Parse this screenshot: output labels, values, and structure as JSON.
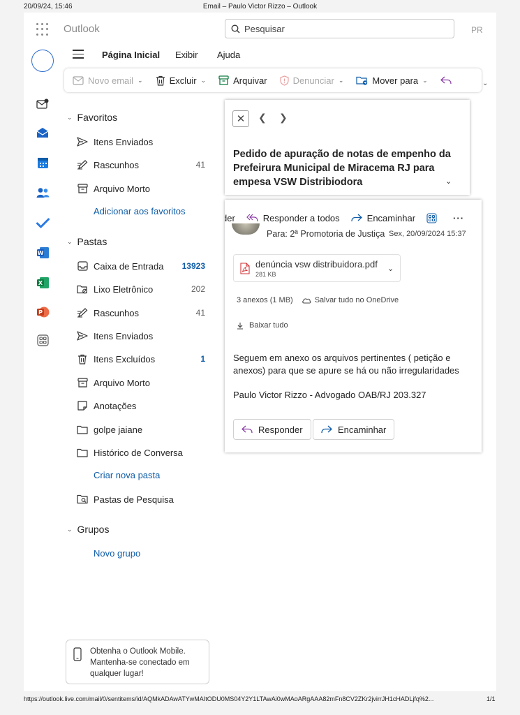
{
  "print": {
    "datetime": "20/09/24, 15:46",
    "doc_title": "Email – Paulo Victor Rizzo – Outlook",
    "url": "https://outlook.live.com/mail/0/sentitems/id/AQMkADAwATYwMAItODU0MS04Y2Y1LTAwAi0wMAoARgAAA82mFn8CV2ZKr2jvirrJH1cHADLjfq%2...",
    "page_num": "1/1"
  },
  "topbar": {
    "app_name": "Outlook",
    "search_placeholder": "Pesquisar",
    "user_initials": "PR"
  },
  "ribbon": {
    "tabs": [
      "Página Inicial",
      "Exibir",
      "Ajuda"
    ],
    "new_email": "Novo email",
    "delete": "Excluir",
    "archive": "Arquivar",
    "report": "Denunciar",
    "move_to": "Mover para"
  },
  "favorites": {
    "title": "Favoritos",
    "items": [
      {
        "label": "Itens Enviados",
        "count": ""
      },
      {
        "label": "Rascunhos",
        "count": "41"
      },
      {
        "label": "Arquivo Morto",
        "count": ""
      }
    ],
    "add_link": "Adicionar aos favoritos"
  },
  "folders": {
    "title": "Pastas",
    "items": [
      {
        "label": "Caixa de Entrada",
        "count": "13923"
      },
      {
        "label": "Lixo Eletrônico",
        "count": "202"
      },
      {
        "label": "Rascunhos",
        "count": "41"
      },
      {
        "label": "Itens Enviados",
        "count": ""
      },
      {
        "label": "Itens Excluídos",
        "count": "1"
      },
      {
        "label": "Arquivo Morto",
        "count": ""
      },
      {
        "label": "Anotações",
        "count": ""
      },
      {
        "label": "golpe jaiane",
        "count": ""
      },
      {
        "label": "Histórico de Conversa",
        "count": ""
      }
    ],
    "create_link": "Criar nova pasta",
    "search_folders": "Pastas de Pesquisa"
  },
  "groups": {
    "title": "Grupos",
    "new_link": "Novo grupo"
  },
  "mobile_promo": {
    "line1": "Obtenha o Outlook Mobile.",
    "line2": "Mantenha-se conectado em",
    "line3": "qualquer lugar!"
  },
  "message": {
    "subject": "Pedido de apuração de notas de empenho da Prefeirura Municipal de Miracema RJ para empesa VSW Distribiodora",
    "action_partial": "der",
    "reply_all": "Responder a todos",
    "forward": "Encaminhar",
    "to_line": "Para:  2ª Promotoria de Justiça",
    "sent_time": "Sex, 20/09/2024 15:37",
    "attachment_name": "denúncia vsw distribuidora.pdf",
    "attachment_size": "281 KB",
    "attachments_count": "3 anexos (1 MB)",
    "save_onedrive": "Salvar tudo no OneDrive",
    "download_all": "Baixar tudo",
    "body": "Seguem em anexo os arquivos pertinentes ( petição e anexos)  para que se apure se há ou não irregularidades",
    "signature": "Paulo Victor Rizzo - Advogado OAB/RJ 203.327",
    "reply_btn": "Responder",
    "forward_btn": "Encaminhar"
  },
  "colors": {
    "accent": "#0f5ca8",
    "reply_purple": "#8b3fa6"
  }
}
